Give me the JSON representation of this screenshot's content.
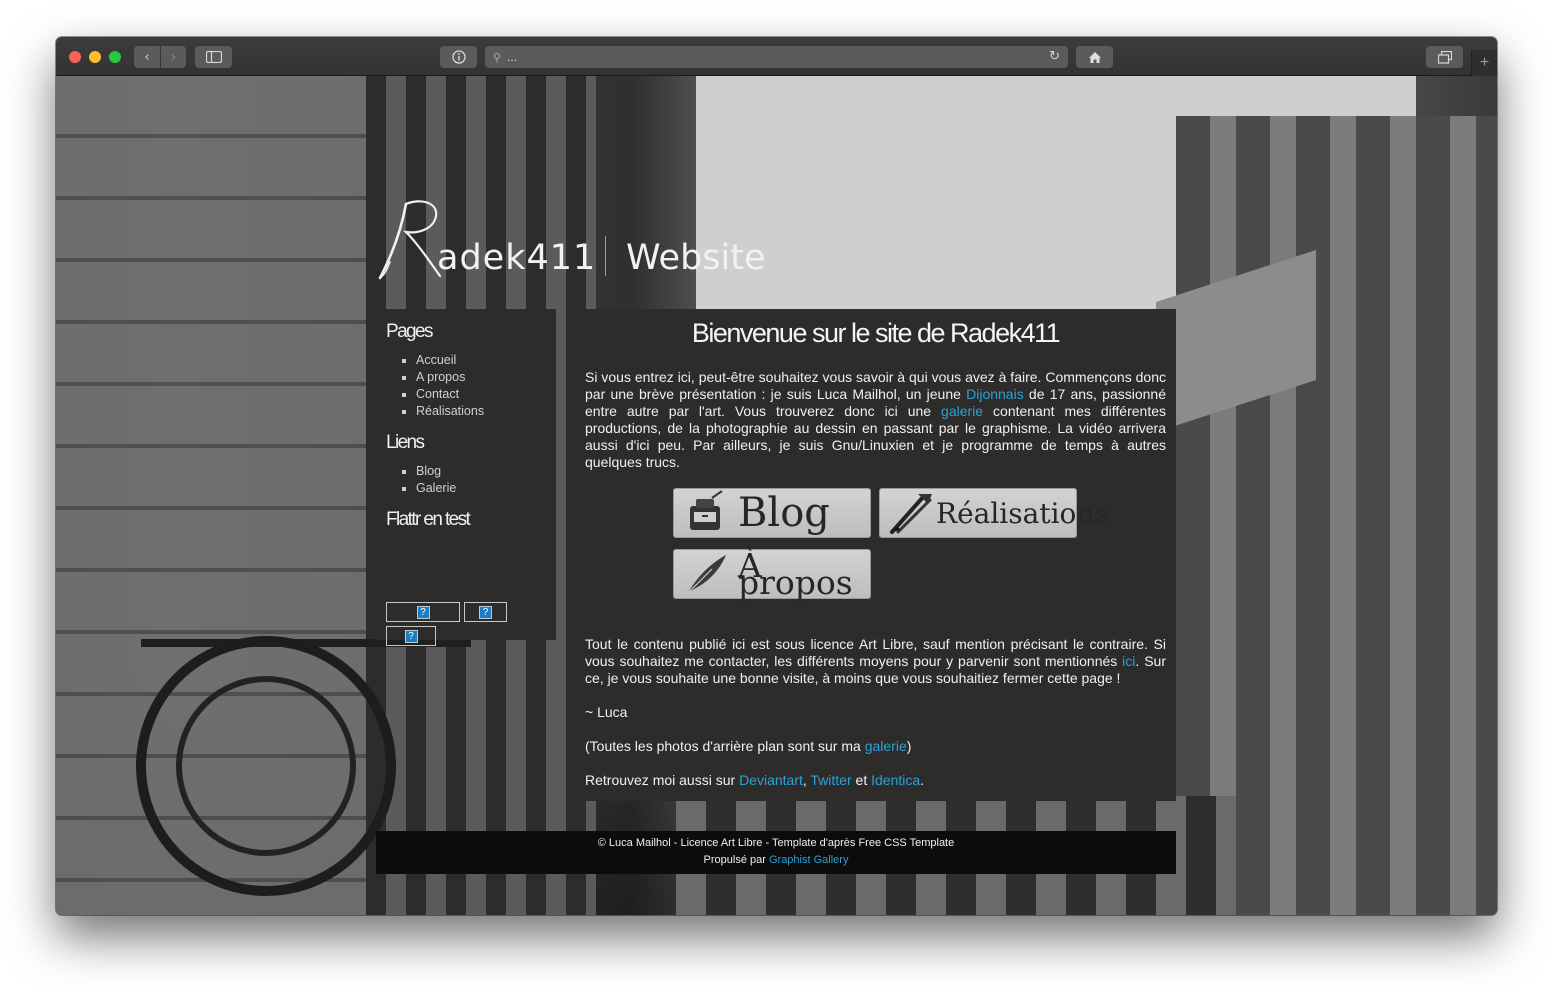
{
  "browser": {
    "address_text": "...",
    "icons": {
      "back": "chevron-left-icon",
      "forward": "chevron-right-icon",
      "sidebar": "sidebar-icon",
      "info": "info-icon",
      "search": "search-icon",
      "reload": "reload-icon",
      "home": "home-icon",
      "tabs": "tabs-icon",
      "new_tab": "plus-icon"
    }
  },
  "logo": {
    "name": "adek411",
    "subtitle": "Website"
  },
  "sidebar": {
    "pages_title": "Pages",
    "pages": [
      "Accueil",
      "A propos",
      "Contact",
      "Réalisations"
    ],
    "liens_title": "Liens",
    "liens": [
      "Blog",
      "Galerie"
    ],
    "flattr_title": "Flattr en test",
    "flattr_placeholder": "?"
  },
  "content": {
    "title": "Bienvenue sur le site de Radek411",
    "intro": {
      "t1": "Si vous entrez ici, peut-être souhaitez vous savoir à qui vous avez à faire. Commençons donc par une brève présentation : je suis Luca Mailhol, un jeune ",
      "link1": "Dijonnais",
      "t2": " de 17 ans, passionné entre autre par l'art. Vous trouverez donc ici une ",
      "link2": "galerie",
      "t3": " contenant mes différentes productions, de la photographie au dessin en passant par le graphisme. La vidéo arrivera aussi d'ici peu. Par ailleurs, je suis Gnu/Linuxien et je programme de temps à autres quelques trucs."
    },
    "buttons": {
      "blog": "Blog",
      "realisations": "Réalisations",
      "apropos": "À propos"
    },
    "licence": {
      "t1": "Tout le contenu publié ici est sous licence Art Libre, sauf mention précisant le contraire. Si vous souhaitez me contacter, les différents moyens pour y parvenir sont mentionnés ",
      "link": "ici",
      "t2": ". Sur ce, je vous souhaite une bonne visite, à moins que vous souhaitiez fermer cette page !"
    },
    "signature": "~ Luca",
    "photos": {
      "t1": "(Toutes les photos d'arrière plan sont sur ma ",
      "link": "galerie",
      "t2": ")"
    },
    "social": {
      "t1": "Retrouvez moi aussi sur ",
      "deviantart": "Deviantart",
      "sep": ", ",
      "twitter": "Twitter",
      "and": " et ",
      "identica": "Identica",
      "end": "."
    }
  },
  "footer": {
    "line1": "© Luca Mailhol - Licence Art Libre - Template d'après Free CSS Template",
    "line2_prefix": "Propulsé par ",
    "line2_link": "Graphist Gallery"
  },
  "colors": {
    "link": "#2aa3d8",
    "panel": "#2e2b2b",
    "footer": "#0c0c0c"
  }
}
